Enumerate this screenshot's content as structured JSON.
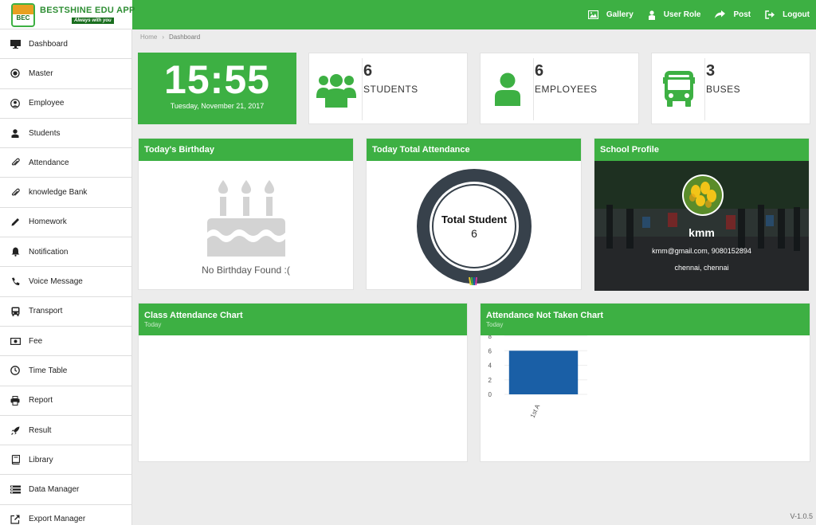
{
  "brand": {
    "title": "BESTSHINE EDU APP",
    "tagline": "Always with you",
    "emblem": "BEC"
  },
  "topnav": [
    {
      "label": "Gallery",
      "icon": "image-icon"
    },
    {
      "label": "User Role",
      "icon": "user-lock-icon"
    },
    {
      "label": "Post",
      "icon": "share-icon"
    },
    {
      "label": "Logout",
      "icon": "logout-icon"
    }
  ],
  "sidebar": {
    "items": [
      {
        "label": "Dashboard",
        "icon": "monitor-icon"
      },
      {
        "label": "Master",
        "icon": "record-icon"
      },
      {
        "label": "Employee",
        "icon": "user-circle-icon"
      },
      {
        "label": "Students",
        "icon": "user-icon"
      },
      {
        "label": "Attendance",
        "icon": "paperclip-icon"
      },
      {
        "label": "knowledge Bank",
        "icon": "paperclip-icon"
      },
      {
        "label": "Homework",
        "icon": "pencil-icon"
      },
      {
        "label": "Notification",
        "icon": "bell-icon"
      },
      {
        "label": "Voice Message",
        "icon": "phone-icon"
      },
      {
        "label": "Transport",
        "icon": "bus-icon"
      },
      {
        "label": "Fee",
        "icon": "money-icon"
      },
      {
        "label": "Time Table",
        "icon": "clock-icon"
      },
      {
        "label": "Report",
        "icon": "print-icon"
      },
      {
        "label": "Result",
        "icon": "rocket-icon"
      },
      {
        "label": "Library",
        "icon": "book-icon"
      },
      {
        "label": "Data Manager",
        "icon": "tasks-icon"
      },
      {
        "label": "Export Manager",
        "icon": "external-link-icon"
      }
    ]
  },
  "breadcrumb": {
    "home": "Home",
    "current": "Dashboard"
  },
  "clock": {
    "time": "15:55",
    "date": "Tuesday, November 21, 2017"
  },
  "stats": {
    "students": {
      "count": "6",
      "label": "STUDENTS"
    },
    "employees": {
      "count": "6",
      "label": "EMPLOYEES"
    },
    "buses": {
      "count": "3",
      "label": "BUSES"
    }
  },
  "panels": {
    "birthday": {
      "title": "Today's Birthday",
      "empty": "No Birthday Found :("
    },
    "attendance": {
      "title": "Today Total Attendance",
      "center_label": "Total Student",
      "center_value": "6"
    },
    "profile": {
      "title": "School Profile",
      "name": "kmm",
      "contact": "kmm@gmail.com, 9080152894",
      "location": "chennai, chennai"
    },
    "class_chart": {
      "title": "Class Attendance Chart",
      "subtitle": "Today"
    },
    "not_taken": {
      "title": "Attendance Not Taken Chart",
      "subtitle": "Today"
    }
  },
  "chart_data": {
    "type": "bar",
    "categories": [
      "1st A"
    ],
    "values": [
      6
    ],
    "ylim": [
      0,
      8
    ],
    "yticks": [
      0,
      2,
      4,
      6,
      8
    ],
    "color": "#1a5fa6"
  },
  "colors": {
    "primary": "#3db043",
    "dark": "#37414b"
  },
  "version": "V-1.0.5"
}
